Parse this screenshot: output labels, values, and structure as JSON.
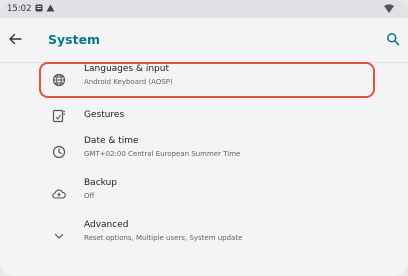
{
  "status_bar": {
    "time": "15:02"
  },
  "app_bar": {
    "title": "System",
    "back_icon": "arrow-back-icon",
    "search_icon": "search-icon"
  },
  "settings": [
    {
      "icon": "globe-icon",
      "title": "Languages & input",
      "summary": "Android Keyboard (AOSP)"
    },
    {
      "icon": "gestures-icon",
      "title": "Gestures",
      "summary": ""
    },
    {
      "icon": "clock-icon",
      "title": "Date & time",
      "summary": "GMT+02:00 Central European Summer Time"
    },
    {
      "icon": "cloud-upload-icon",
      "title": "Backup",
      "summary": "Off"
    },
    {
      "icon": "chevron-down-icon",
      "title": "Advanced",
      "summary": "Reset options, Multiple users, System update"
    }
  ],
  "colors": {
    "accent": "#007a8a",
    "highlight": "#e0533d"
  }
}
